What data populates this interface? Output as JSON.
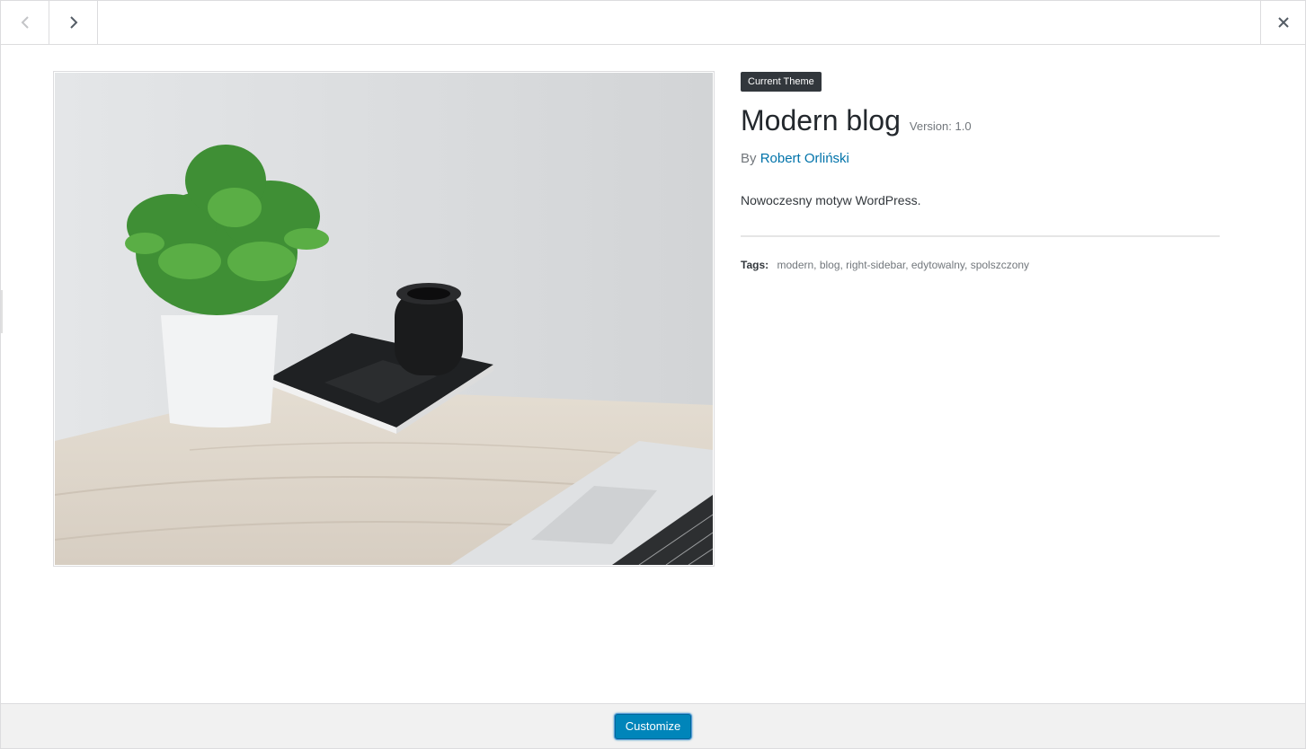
{
  "header": {
    "prev_icon": "chevron-left-icon",
    "next_icon": "chevron-right-icon",
    "close_icon": "close-icon"
  },
  "theme": {
    "badge": "Current Theme",
    "name": "Modern blog",
    "version": "Version: 1.0",
    "author_prefix": "By",
    "author": "Robert Orliński",
    "description": "Nowoczesny motyw WordPress.",
    "tags_label": "Tags:",
    "tags": "modern, blog, right-sidebar, edytowalny, spolszczony"
  },
  "footer": {
    "customize_label": "Customize"
  },
  "colors": {
    "accent": "#0085ba",
    "link": "#0073aa",
    "badge_bg": "#32373c"
  }
}
